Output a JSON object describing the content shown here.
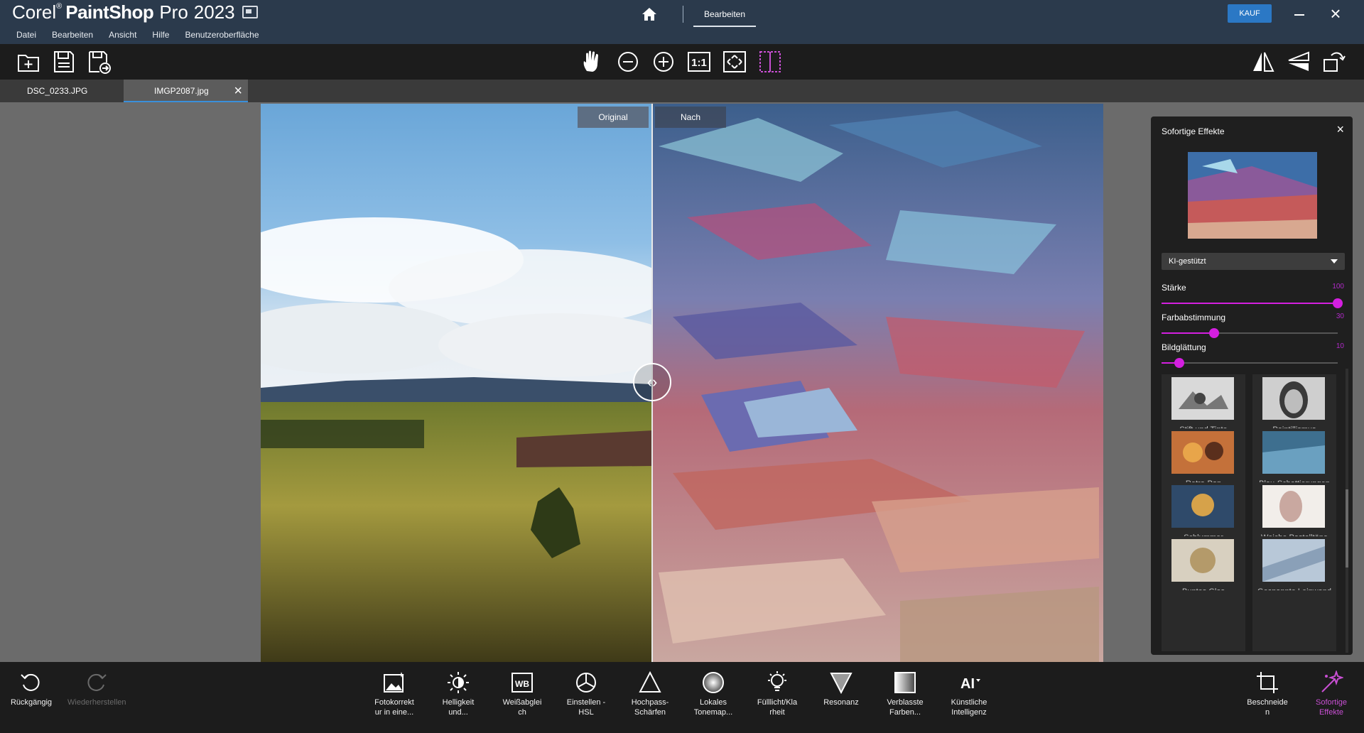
{
  "app": {
    "brand_corel": "Corel",
    "brand_reg": "®",
    "brand_psp": "PaintShop",
    "brand_pro": "Pro",
    "brand_year": "2023",
    "mode_tab": "Bearbeiten",
    "buy_label": "KAUF"
  },
  "menu": [
    "Datei",
    "Bearbeiten",
    "Ansicht",
    "Hilfe",
    "Benutzeroberfläche"
  ],
  "toolbar_icons": {
    "left": [
      "new-file-icon",
      "save-icon",
      "save-as-icon"
    ],
    "center": [
      "pan-hand-icon",
      "zoom-out-icon",
      "zoom-in-icon",
      "actual-size-icon",
      "fit-window-icon",
      "compare-split-icon"
    ],
    "right": [
      "flip-horizontal-icon",
      "flip-vertical-icon",
      "rotate-icon"
    ],
    "actual_size_label": "1:1"
  },
  "tabs": [
    {
      "label": "DSC_0233.JPG",
      "active": false
    },
    {
      "label": "IMGP2087.jpg",
      "active": true
    }
  ],
  "compare": {
    "original_label": "Original",
    "after_label": "Nach"
  },
  "panel": {
    "title": "Sofortige Effekte",
    "dropdown_value": "KI-gestützt",
    "sliders": [
      {
        "label": "Stärke",
        "value": 100,
        "display": "100"
      },
      {
        "label": "Farbabstimmung",
        "value": 30,
        "display": "30"
      },
      {
        "label": "Bildglättung",
        "value": 10,
        "display": "10"
      }
    ],
    "effects": [
      "Stift und Tinte",
      "Pointillismus",
      "Retro-Pop",
      "Blau-Schattierungen",
      "Schlummer",
      "Weiche Pastelltöne",
      "Buntes Glas",
      "Gespannte Leinwand"
    ]
  },
  "bottom": {
    "left": [
      {
        "label": "Rückgängig",
        "enabled": true
      },
      {
        "label": "Wiederherstellen",
        "enabled": false
      }
    ],
    "center": [
      {
        "label1": "Fotokorrekt",
        "label2": "ur in eine..."
      },
      {
        "label1": "Helligkeit",
        "label2": "und..."
      },
      {
        "label1": "Weißabglei",
        "label2": "ch"
      },
      {
        "label1": "Einstellen -",
        "label2": "HSL"
      },
      {
        "label1": "Hochpass-",
        "label2": "Schärfen"
      },
      {
        "label1": "Lokales",
        "label2": "Tonemap..."
      },
      {
        "label1": "Fülllicht/Kla",
        "label2": "rheit"
      },
      {
        "label1": "Resonanz",
        "label2": ""
      },
      {
        "label1": "Verblasste",
        "label2": "Farben..."
      },
      {
        "label1": "Künstliche",
        "label2": "Intelligenz"
      }
    ],
    "wb_text": "WB",
    "ai_text": "AI",
    "right": [
      {
        "label1": "Beschneide",
        "label2": "n"
      },
      {
        "label1": "Sofortige",
        "label2": "Effekte"
      }
    ]
  },
  "colors": {
    "titlebar": "#2b3a4c",
    "accent": "#d41fe0",
    "tab_underline": "#3a8fdb",
    "buy": "#2b78c5"
  }
}
